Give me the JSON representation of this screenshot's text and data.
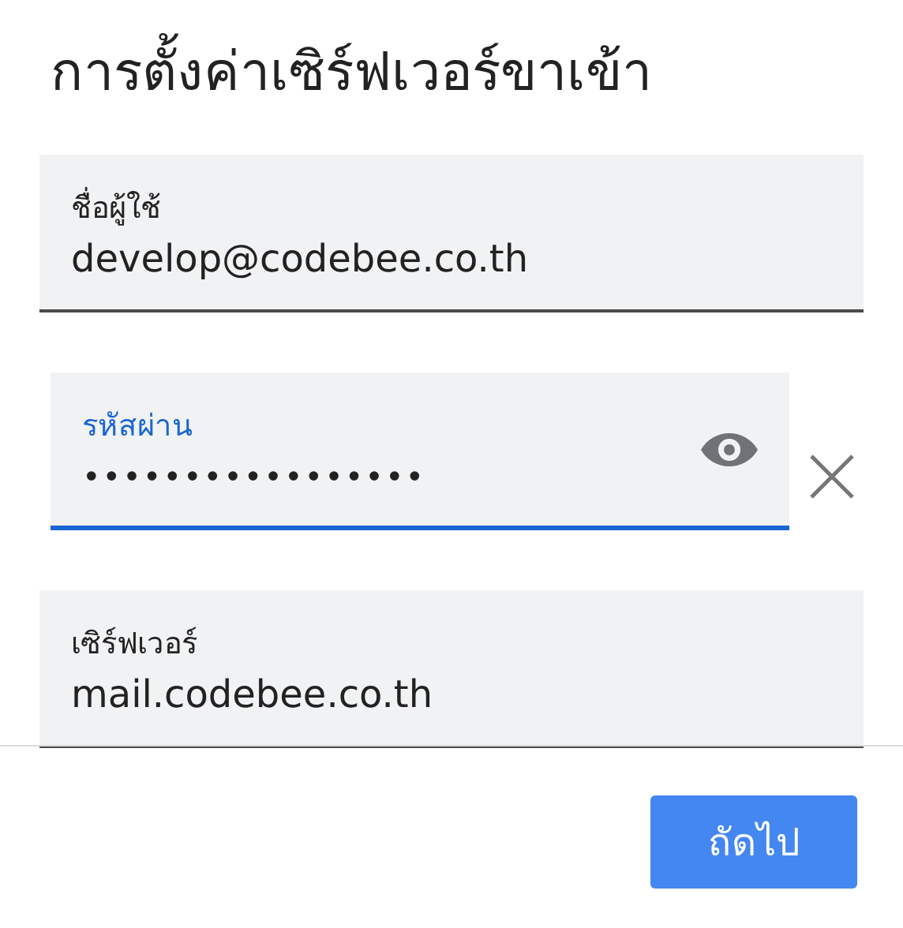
{
  "title": "การตั้งค่าเซิร์ฟเวอร์ขาเข้า",
  "fields": [
    {
      "kind": "text",
      "label": "ชื่อผู้ใช้",
      "value": "develop@codebee.co.th",
      "focused": false
    },
    {
      "kind": "password",
      "label": "รหัสผ่าน",
      "value": "•••••••••••••••••",
      "focused": true
    },
    {
      "kind": "text",
      "label": "เซิร์ฟเวอร์",
      "value": "mail.codebee.co.th",
      "focused": false
    }
  ],
  "next_button": "ถัดไป"
}
